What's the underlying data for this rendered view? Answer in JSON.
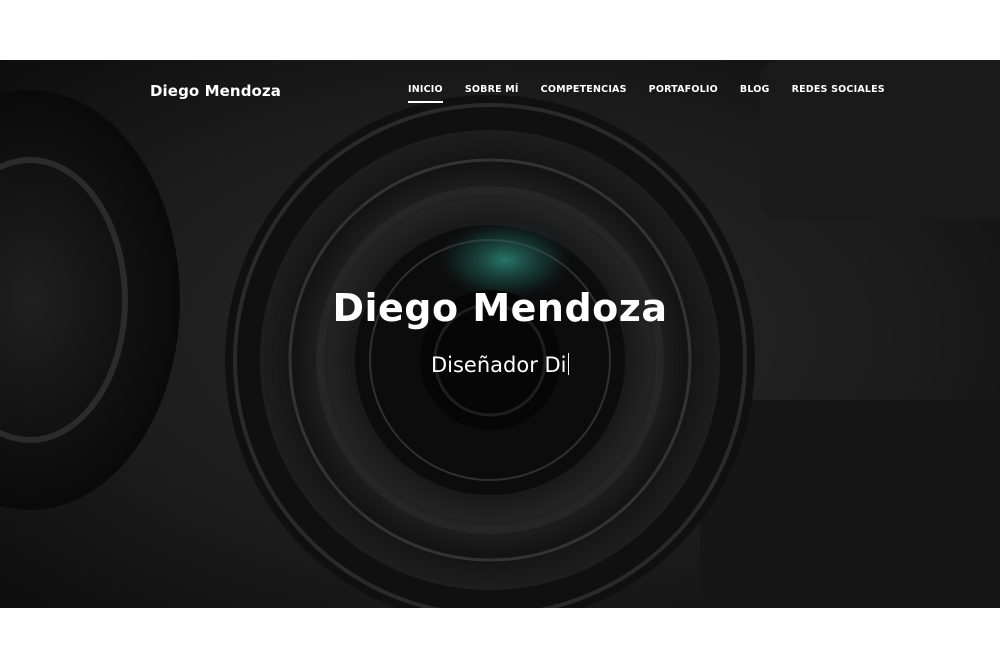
{
  "header": {
    "brand": "Diego Mendoza"
  },
  "nav": {
    "items": [
      {
        "label": "INICIO",
        "active": true
      },
      {
        "label": "SOBRE MÍ",
        "active": false
      },
      {
        "label": "COMPETENCIAS",
        "active": false
      },
      {
        "label": "PORTAFOLIO",
        "active": false
      },
      {
        "label": "BLOG",
        "active": false
      },
      {
        "label": "REDES SOCIALES",
        "active": false
      }
    ]
  },
  "hero": {
    "title": "Diego Mendoza",
    "subtitle": "Diseñador Di",
    "background": "camera-lens-photo"
  },
  "colors": {
    "text": "#ffffff",
    "background": "#141414",
    "page": "#ffffff",
    "lens_glint": "#2f8a78"
  }
}
